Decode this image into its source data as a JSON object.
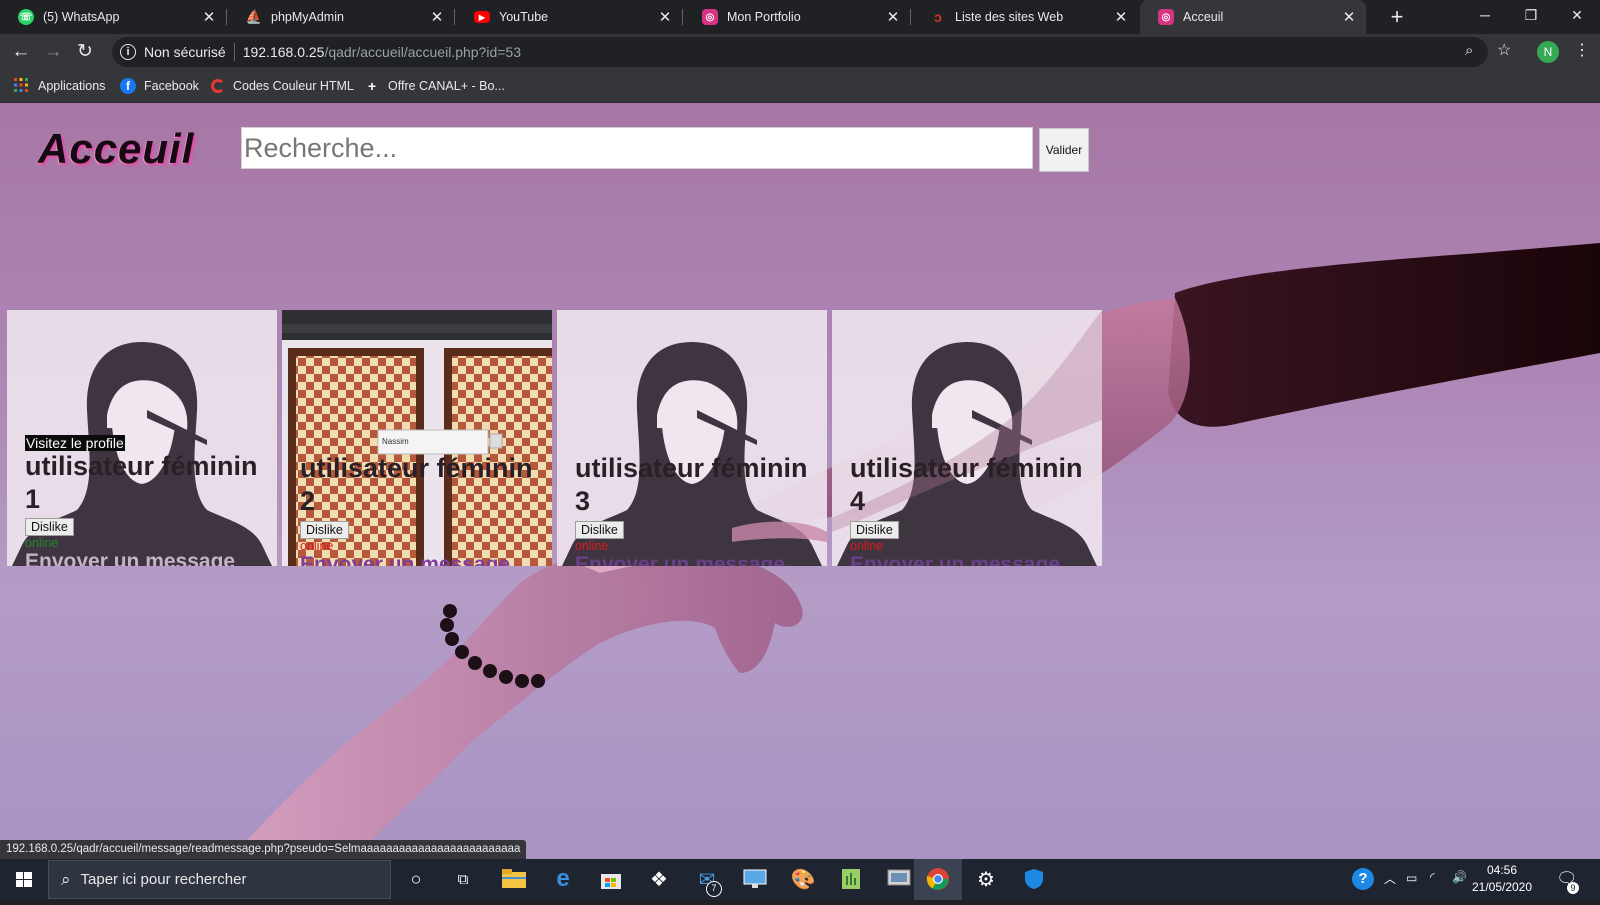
{
  "browser": {
    "tabs": [
      {
        "title": "(5) WhatsApp",
        "icon": "whatsapp-icon",
        "color": "#25d366",
        "active": false
      },
      {
        "title": "phpMyAdmin",
        "icon": "phpmyadmin-icon",
        "color": "#f29111",
        "active": false
      },
      {
        "title": "YouTube",
        "icon": "youtube-icon",
        "color": "#ff0000",
        "active": false
      },
      {
        "title": "Mon Portfolio",
        "icon": "portfolio-icon",
        "color": "#d63384",
        "active": false
      },
      {
        "title": "Liste des sites Web",
        "icon": "sites-icon",
        "color": "#d93025",
        "active": false
      },
      {
        "title": "Acceuil",
        "icon": "accueil-icon",
        "color": "#d63384",
        "active": true
      }
    ],
    "security_label": "Non sécurisé",
    "url_host": "192.168.0.25",
    "url_path": "/qadr/accueil/accueil.php?id=53",
    "profile_initial": "N",
    "bookmarks": [
      {
        "label": "Applications",
        "icon": "apps-grid-icon"
      },
      {
        "label": "Facebook",
        "icon": "facebook-icon"
      },
      {
        "label": "Codes Couleur HTML",
        "icon": "color-codes-icon"
      },
      {
        "label": "Offre CANAL+ - Bo...",
        "icon": "canal-icon"
      }
    ],
    "status_url": "192.168.0.25/qadr/accueil/message/readmessage.php?pseudo=Selmaaaaaaaaaaaaaaaaaaaaaaaaa"
  },
  "page": {
    "logo": "Acceuil",
    "search_placeholder": "Recherche...",
    "submit_label": "Valider",
    "cards": [
      {
        "visit_label": "Visitez le profile",
        "name": "utilisateur féminin 1",
        "dislike": "Dislike",
        "status": "online",
        "status_color": "#1e8a2a",
        "message": "Envoyer un message",
        "photo": "avatar-female"
      },
      {
        "name": "utilisateur féminin 2",
        "dislike": "Dislike",
        "status": "online",
        "status_color": "#d91a1a",
        "message": "Envoyer un message",
        "photo": "chess-screenshot"
      },
      {
        "name": "utilisateur féminin 3",
        "dislike": "Dislike",
        "status": "online",
        "status_color": "#d91a1a",
        "message": "Envoyer un message",
        "photo": "avatar-female"
      },
      {
        "name": "utilisateur féminin 4",
        "dislike": "Dislike",
        "status": "online",
        "status_color": "#d91a1a",
        "message": "Envoyer un message",
        "photo": "avatar-female"
      }
    ],
    "chess_popup_text": "Nassim"
  },
  "taskbar": {
    "search_placeholder": "Taper ici pour rechercher",
    "mail_badge": "7",
    "time": "04:56",
    "date": "21/05/2020",
    "notification_count": "9"
  }
}
